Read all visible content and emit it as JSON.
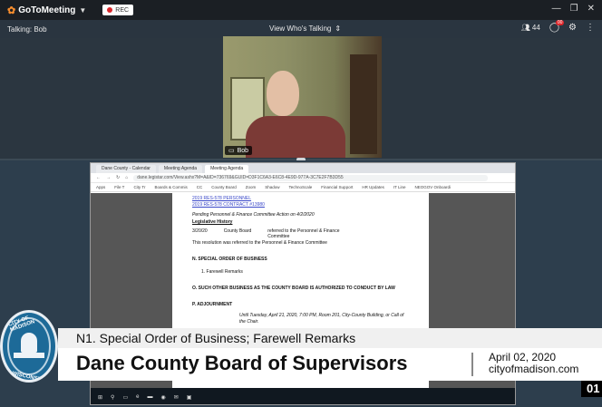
{
  "app": {
    "brand": "GoToMeeting",
    "rec_label": "REC",
    "talking": "Talking: Bob",
    "view_mode": "View Who's Talking",
    "attendee_count": "44",
    "chat_badge": "00"
  },
  "webcam": {
    "participant_name": "Bob"
  },
  "browser": {
    "tabs": [
      "Dane County - Calendar",
      "Meeting Agenda",
      "Meeting Agenda"
    ],
    "url": "dane.legistar.com/View.ashx?M=A&ID=736769&GUID=D3F1C6A3-E6C8-4E9D-977A-3C7E2F7B3D55",
    "bookmarks": [
      "Apps",
      "File T",
      "City Tr",
      "Boards & Commis",
      "CC",
      "County Board",
      "Zoom",
      "Shadow",
      "TechnoScale",
      "Financial Support",
      "HR Updates",
      "IT Line",
      "NEOGOV Onboardi"
    ]
  },
  "agenda": {
    "links": [
      "2019 RES-578 PERSONNEL",
      "2019 RES-578 CONTRACT #13980"
    ],
    "pending": "Pending Personnel & Finance Committee Action on 4/2/2020",
    "history_label": "Legislative History",
    "history_date": "3/20/20",
    "history_body": "County Board",
    "history_action": "referred to the Personnel & Finance Committee",
    "history_note": "This resolution was referred to the Personnel & Finance Committee",
    "section_n": "N. SPECIAL ORDER OF BUSINESS",
    "item_1": "1.  Farewell Remarks",
    "section_o": "O. SUCH OTHER BUSINESS AS THE COUNTY BOARD IS AUTHORIZED TO CONDUCT BY LAW",
    "section_p": "P. ADJOURNMENT",
    "adjourn_text": "Until Tuesday, April 21, 2020, 7:00 PM, Room 201, City-County Building, or Call of the Chair."
  },
  "lower_third": {
    "seal_top": "CITY OF MADISON",
    "seal_bottom": "WISCONSIN",
    "subtitle": "N1. Special Order of Business; Farewell Remarks",
    "title": "Dane County Board of Supervisors",
    "date": "April 02, 2020",
    "site": "cityofmadison.com",
    "timecode": "01"
  }
}
